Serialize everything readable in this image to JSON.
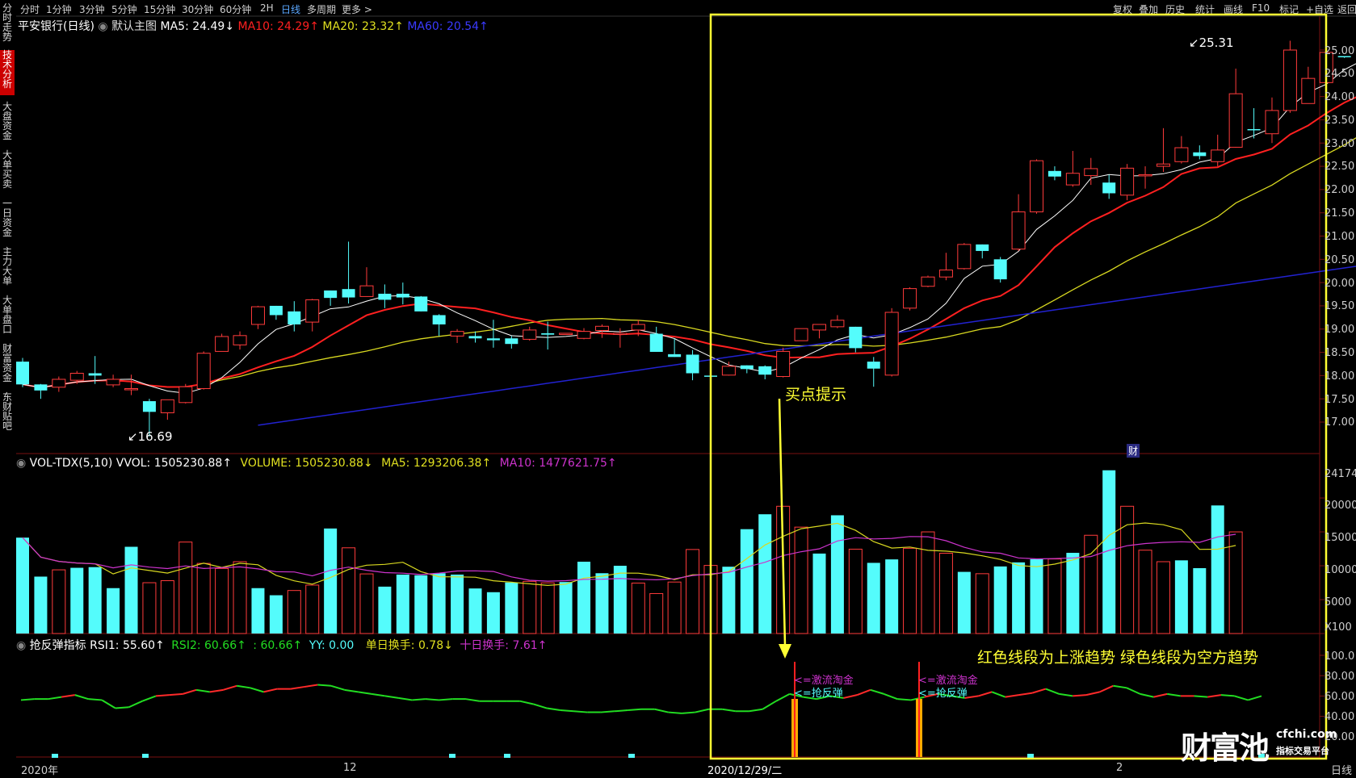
{
  "toolbar": {
    "periods": [
      "分时",
      "1分钟",
      "3分钟",
      "5分钟",
      "15分钟",
      "30分钟",
      "60分钟",
      "2H",
      "日线",
      "多周期",
      "更多 >"
    ],
    "right": [
      "复权",
      "叠加",
      "历史",
      "统计",
      "画线",
      "F10",
      "标记",
      "+自选",
      "返回"
    ]
  },
  "sidebar": [
    "分时走势",
    "技术分析",
    "大盘资金",
    "大单买卖",
    "一日资金",
    "主力大单",
    "大单盘口",
    "财富资金",
    "东财贴吧"
  ],
  "price_header": {
    "name": "平安银行(日线)",
    "main_chart": "默认主图",
    "ma5": "MA5: 24.49↓",
    "ma10": "MA10: 24.29↑",
    "ma20": "MA20: 23.32↑",
    "ma60": "MA60: 20.54↑"
  },
  "vol_header": {
    "name": "VOL-TDX(5,10) VVOL: 1505230.88↑",
    "volume": "VOLUME: 1505230.88↓",
    "ma5": "MA5: 1293206.38↑",
    "ma10": "MA10: 1477621.75↑"
  },
  "ind_header": {
    "name": "抢反弹指标 RSI1: 55.60↑",
    "rsi2": "RSI2: 60.66↑",
    "blank": ": 60.66↑",
    "yy": "YY: 0.00",
    "turn1": "单日换手: 0.78↓",
    "turn10": "十日换手: 7.61↑"
  },
  "annotations": {
    "high": "25.31",
    "low": "16.69",
    "buy_point": "买点提示",
    "trend_note": "红色线段为上涨趋势 绿色线段为空方趋势",
    "signal1_a": "<=激流淘金",
    "signal1_b": "<=抢反弹",
    "signal2_a": "<=激流淘金",
    "signal2_b": "<=抢反弹",
    "cai": "财"
  },
  "price_axis_labels": [
    "25.00",
    "24.50",
    "24.00",
    "23.50",
    "23.00",
    "22.50",
    "22.00",
    "21.50",
    "21.00",
    "20.50",
    "20.00",
    "19.50",
    "19.00",
    "18.50",
    "18.00",
    "17.50",
    "17.00"
  ],
  "vol_axis_labels": [
    "24174",
    "20000",
    "15000",
    "10000",
    "5000",
    "X100"
  ],
  "ind_axis_labels": [
    "100.0",
    "80.00",
    "60.00",
    "40.00",
    "20.00"
  ],
  "date_labels": [
    "2020年",
    "12",
    "2020/12/29/二",
    "2",
    "日线"
  ],
  "watermark": {
    "logo": "财富池",
    "site": "cfchi.com",
    "slogan": "指标交易平台"
  },
  "colors": {
    "up": "#ff3b3b",
    "down": "#54fcfc",
    "ma5": "#ffffff",
    "ma10": "#ff2020",
    "ma20": "#d8d820",
    "ma60": "#2222d0",
    "highlight": "#ffff33",
    "purple": "#cc33cc"
  },
  "chart_data": [
    {
      "type": "candlestick",
      "title": "平安银行(日线)",
      "ylim": [
        16.5,
        25.3
      ],
      "ohlc": [
        [
          18.3,
          18.38,
          17.75,
          17.81
        ],
        [
          17.81,
          17.82,
          17.5,
          17.68
        ],
        [
          17.75,
          17.98,
          17.65,
          17.92
        ],
        [
          17.9,
          18.1,
          17.82,
          18.05
        ],
        [
          18.05,
          18.42,
          17.82,
          18.0
        ],
        [
          17.8,
          18.02,
          17.75,
          17.92
        ],
        [
          17.72,
          18.02,
          17.58,
          17.72
        ],
        [
          17.45,
          17.5,
          16.69,
          17.22
        ],
        [
          17.2,
          17.48,
          17.05,
          17.48
        ],
        [
          17.42,
          17.82,
          17.4,
          17.76
        ],
        [
          17.72,
          18.52,
          17.7,
          18.48
        ],
        [
          18.52,
          18.9,
          18.52,
          18.84
        ],
        [
          18.66,
          18.95,
          18.56,
          18.86
        ],
        [
          19.1,
          19.5,
          19.0,
          19.48
        ],
        [
          19.5,
          19.5,
          19.2,
          19.3
        ],
        [
          19.38,
          19.6,
          18.95,
          19.1
        ],
        [
          19.15,
          19.65,
          18.95,
          19.63
        ],
        [
          19.83,
          19.83,
          19.5,
          19.67
        ],
        [
          19.86,
          20.88,
          19.55,
          19.68
        ],
        [
          19.7,
          20.33,
          19.7,
          19.93
        ],
        [
          19.76,
          19.96,
          19.45,
          19.63
        ],
        [
          19.76,
          20.0,
          19.53,
          19.68
        ],
        [
          19.7,
          19.71,
          19.38,
          19.38
        ],
        [
          19.3,
          19.32,
          18.85,
          19.1
        ],
        [
          18.85,
          19.0,
          18.7,
          18.95
        ],
        [
          18.85,
          18.95,
          18.71,
          18.8
        ],
        [
          18.8,
          19.2,
          18.6,
          18.76
        ],
        [
          18.8,
          18.85,
          18.58,
          18.68
        ],
        [
          18.78,
          19.05,
          18.75,
          18.98
        ],
        [
          18.91,
          19.16,
          18.56,
          18.88
        ],
        [
          18.91,
          18.95,
          18.95,
          18.91
        ],
        [
          18.8,
          19.02,
          18.78,
          18.95
        ],
        [
          18.97,
          19.1,
          18.81,
          19.06
        ],
        [
          18.9,
          19.02,
          18.6,
          18.91
        ],
        [
          18.98,
          19.2,
          18.85,
          19.1
        ],
        [
          18.9,
          19.05,
          18.51,
          18.51
        ],
        [
          18.46,
          18.8,
          18.4,
          18.4
        ],
        [
          18.45,
          18.55,
          17.9,
          18.05
        ],
        [
          18.0,
          18.05,
          17.85,
          17.98
        ],
        [
          18.01,
          18.3,
          18.0,
          18.2
        ],
        [
          18.22,
          18.22,
          18.05,
          18.14
        ],
        [
          18.2,
          18.22,
          17.92,
          18.02
        ],
        [
          17.98,
          18.6,
          17.96,
          18.52
        ],
        [
          18.75,
          19.01,
          18.75,
          19.01
        ],
        [
          18.98,
          19.1,
          18.8,
          19.1
        ],
        [
          19.05,
          19.3,
          19.02,
          19.19
        ],
        [
          19.05,
          19.05,
          18.5,
          18.59
        ],
        [
          18.3,
          18.4,
          17.76,
          18.15
        ],
        [
          18.01,
          19.45,
          17.98,
          19.36
        ],
        [
          19.45,
          19.9,
          19.4,
          19.87
        ],
        [
          19.92,
          20.15,
          19.9,
          20.12
        ],
        [
          20.12,
          20.64,
          20.05,
          20.27
        ],
        [
          20.3,
          20.85,
          20.28,
          20.82
        ],
        [
          20.82,
          20.82,
          20.52,
          20.68
        ],
        [
          20.5,
          20.55,
          20.0,
          20.07
        ],
        [
          20.72,
          21.9,
          20.68,
          21.52
        ],
        [
          21.52,
          22.65,
          21.48,
          22.62
        ],
        [
          22.4,
          22.5,
          22.2,
          22.28
        ],
        [
          22.1,
          22.83,
          22.06,
          22.35
        ],
        [
          22.3,
          22.68,
          22.1,
          22.45
        ],
        [
          22.15,
          22.32,
          21.8,
          21.92
        ],
        [
          21.88,
          22.55,
          21.77,
          22.46
        ],
        [
          22.32,
          22.5,
          22.02,
          22.32
        ],
        [
          22.5,
          23.32,
          22.38,
          22.55
        ],
        [
          22.6,
          23.15,
          22.56,
          22.9
        ],
        [
          22.8,
          22.95,
          22.65,
          22.72
        ],
        [
          22.6,
          23.18,
          22.5,
          22.85
        ],
        [
          22.91,
          24.6,
          22.9,
          24.06
        ],
        [
          23.3,
          23.75,
          23.1,
          23.29
        ],
        [
          23.2,
          23.98,
          23.0,
          23.7
        ],
        [
          23.7,
          25.2,
          23.65,
          25.0
        ],
        [
          23.85,
          24.64,
          23.85,
          24.39
        ],
        [
          24.3,
          25.31,
          24.15,
          24.95
        ],
        [
          24.87,
          24.87,
          24.83,
          24.85
        ],
        [
          24.85,
          24.85,
          24.2,
          24.7
        ],
        [
          24.54,
          24.85,
          23.95,
          24.48
        ],
        [
          24.48,
          24.95,
          23.35,
          23.96
        ],
        [
          24.01,
          24.32,
          23.55,
          24.3
        ]
      ]
    },
    {
      "type": "bar",
      "title": "VOL-TDX(5,10)",
      "unit": "X100",
      "ylim": [
        0,
        24174
      ],
      "values": [
        14150,
        8400,
        9400,
        9700,
        9800,
        6700,
        12800,
        7500,
        7800,
        13500,
        10350,
        9600,
        10600,
        6700,
        5650,
        6350,
        7150,
        15500,
        12650,
        8800,
        6920,
        8700,
        8600,
        8900,
        8700,
        6650,
        6100,
        7530,
        7700,
        7480,
        7600,
        10600,
        8900,
        10000,
        7450,
        5900,
        7600,
        12400,
        10050,
        9860,
        15400,
        17600,
        18780,
        15700,
        11800,
        17450,
        12450,
        10430,
        10940,
        12580,
        15000,
        11850,
        9100,
        8830,
        9900,
        10500,
        10970,
        11000,
        11910,
        14500,
        24090,
        18780,
        12300,
        10600,
        10800,
        9650,
        18900,
        15000
      ],
      "up": [
        false,
        false,
        true,
        false,
        false,
        false,
        false,
        true,
        true,
        true,
        true,
        true,
        true,
        false,
        false,
        true,
        true,
        false,
        true,
        true,
        false,
        false,
        false,
        false,
        false,
        false,
        false,
        false,
        true,
        true,
        false,
        false,
        false,
        false,
        true,
        true,
        true,
        true,
        true,
        false,
        false,
        false,
        true,
        true,
        false,
        false,
        true,
        false,
        false,
        true,
        true,
        true,
        false,
        true,
        false,
        false,
        false,
        true,
        false,
        true,
        false,
        true,
        true,
        true,
        false,
        false,
        false,
        true
      ]
    },
    {
      "type": "line",
      "title": "抢反弹指标",
      "ylim": [
        0,
        100
      ],
      "series": [
        {
          "name": "RSI1",
          "values": [
            56,
            57,
            57,
            59,
            61,
            57,
            56,
            48,
            49,
            55,
            60,
            61,
            62,
            66,
            64,
            66,
            70,
            68,
            64,
            67,
            67,
            69,
            71,
            70,
            66,
            64,
            62,
            60,
            58,
            56,
            57,
            56,
            57,
            57,
            55,
            55,
            55,
            55,
            52,
            48,
            46,
            45,
            44,
            44,
            45,
            46,
            47,
            47,
            44,
            43,
            44,
            47,
            47,
            45,
            45,
            47,
            55,
            62,
            59,
            57,
            60,
            58,
            61,
            66,
            62,
            57,
            56,
            59,
            62,
            60,
            58,
            60,
            64,
            59,
            61,
            63,
            67,
            62,
            60,
            61,
            64,
            70,
            68,
            62,
            59,
            62,
            60,
            60,
            59,
            61,
            60,
            56,
            60
          ]
        }
      ]
    }
  ]
}
